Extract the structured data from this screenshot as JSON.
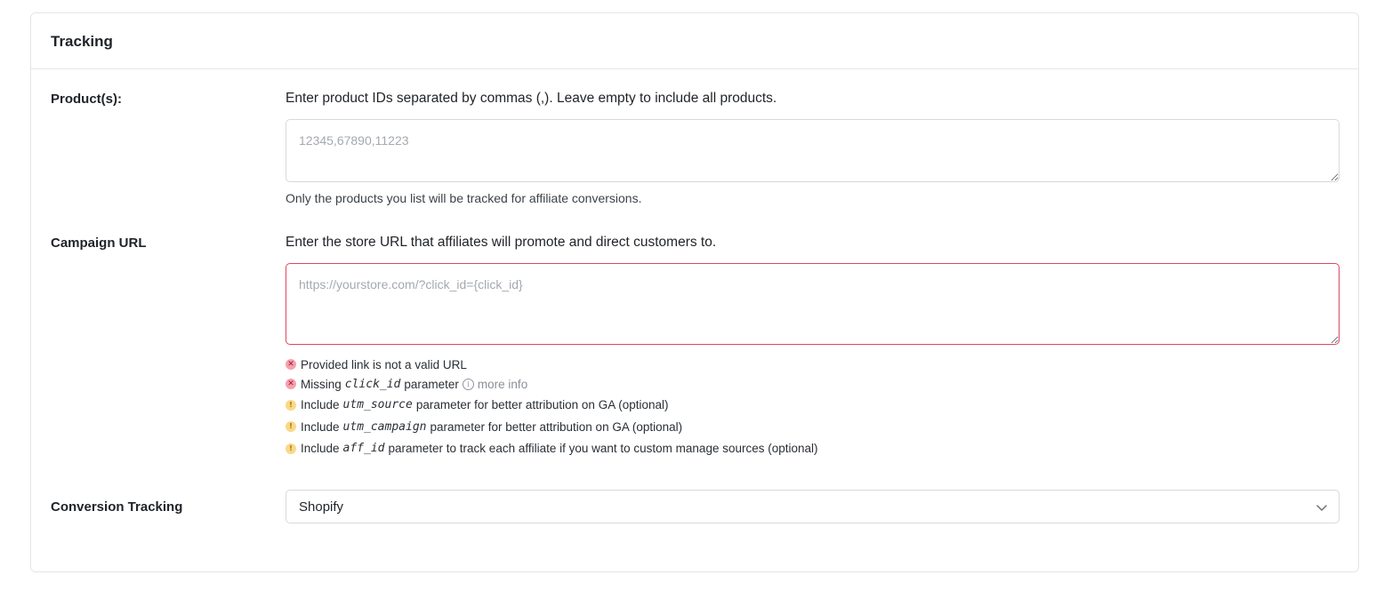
{
  "section": {
    "title": "Tracking"
  },
  "products": {
    "label": "Product(s):",
    "description": "Enter product IDs separated by commas (,). Leave empty to include all products.",
    "value": "",
    "placeholder": "12345,67890,11223",
    "help": "Only the products you list will be tracked for affiliate conversions."
  },
  "campaign": {
    "label": "Campaign URL",
    "description": "Enter the store URL that affiliates will promote and direct customers to.",
    "value": "",
    "placeholder": "https://yourstore.com/?click_id={click_id}",
    "checks": [
      {
        "status": "error",
        "icon": "error-x-icon",
        "text": "Provided link is not a valid URL"
      },
      {
        "status": "error",
        "icon": "error-x-icon",
        "prefix": "Missing",
        "code": "click_id",
        "suffix": "parameter",
        "link": "more info"
      },
      {
        "status": "warning",
        "icon": "warning-exclamation-icon",
        "prefix": "Include",
        "code": "utm_source",
        "suffix": "parameter for better attribution on GA (optional)"
      },
      {
        "status": "warning",
        "icon": "warning-exclamation-icon",
        "prefix": "Include",
        "code": "utm_campaign",
        "suffix": "parameter for better attribution on GA (optional)"
      },
      {
        "status": "warning",
        "icon": "warning-exclamation-icon",
        "prefix": "Include",
        "code": "aff_id",
        "suffix": "parameter to track each affiliate if you want to custom manage sources (optional)"
      }
    ]
  },
  "conversion": {
    "label": "Conversion Tracking",
    "selected": "Shopify"
  },
  "colors": {
    "error": "#e0475f",
    "warning": "#f5c84c",
    "border": "#d6d9dd"
  }
}
